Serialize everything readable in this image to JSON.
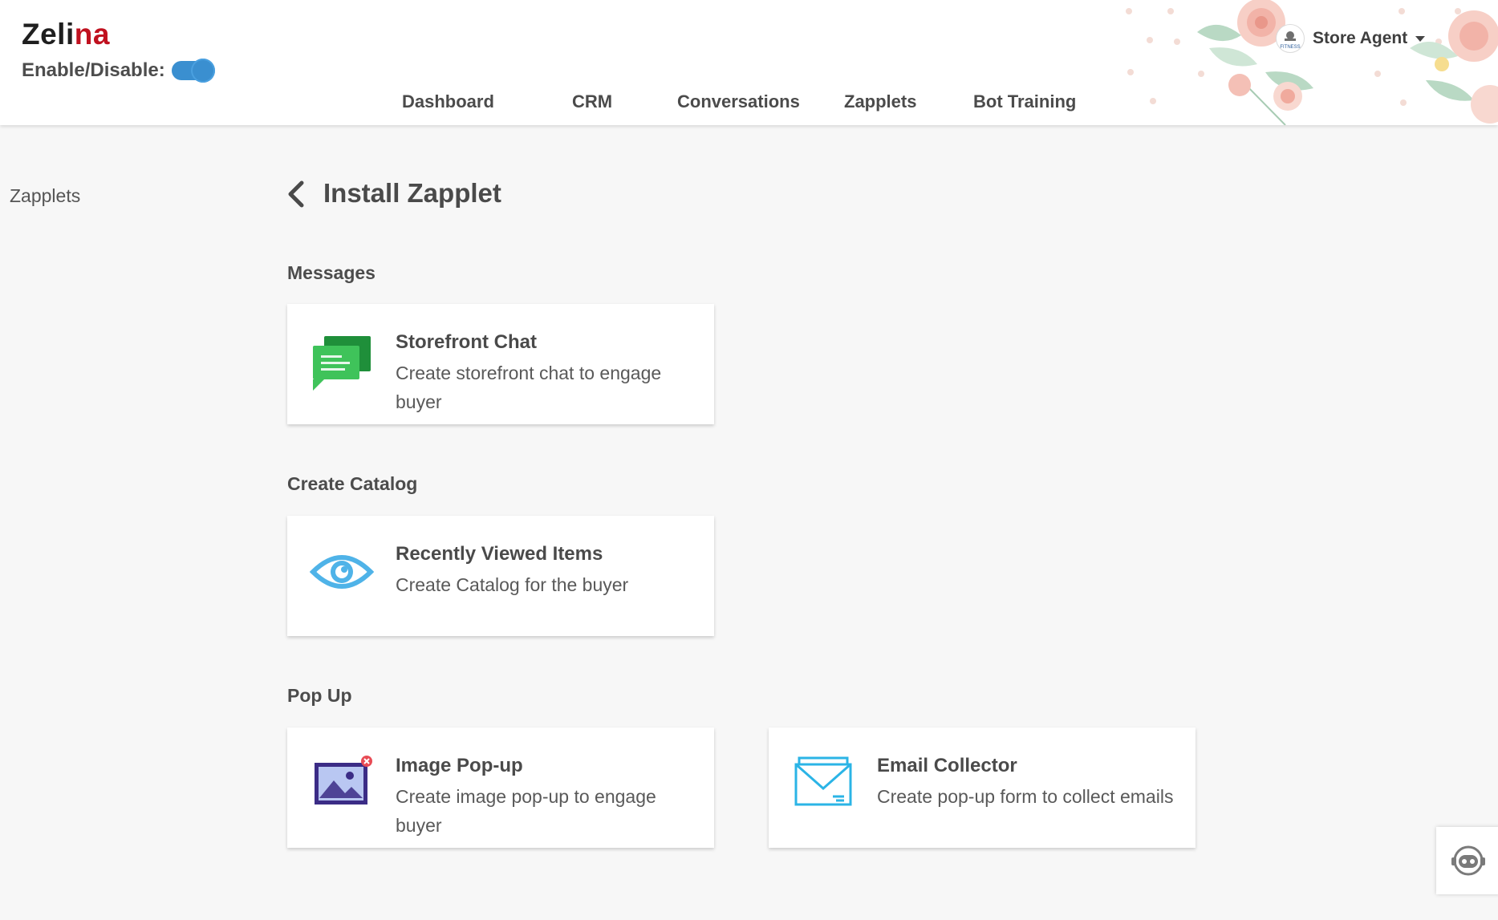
{
  "header": {
    "brand_main": "Zeli",
    "brand_accent": "na",
    "toggle_label": "Enable/Disable:",
    "toggle_on": true,
    "accent_color": "#c0111f",
    "toggle_color": "#3a8fd0"
  },
  "nav": {
    "items": [
      {
        "label": "Dashboard"
      },
      {
        "label": "CRM"
      },
      {
        "label": "Conversations"
      },
      {
        "label": "Zapplets"
      },
      {
        "label": "Bot Training"
      }
    ]
  },
  "agent": {
    "name": "Store Agent",
    "avatar_text": "FITNESS"
  },
  "sidebar": {
    "items": [
      {
        "label": "Zapplets"
      }
    ]
  },
  "main": {
    "title": "Install Zapplet",
    "sections": [
      {
        "title": "Messages",
        "cards": [
          {
            "icon": "chat-bubbles-icon",
            "title": "Storefront Chat",
            "description": "Create storefront chat to engage buyer"
          }
        ]
      },
      {
        "title": "Create Catalog",
        "cards": [
          {
            "icon": "eye-icon",
            "title": "Recently Viewed Items",
            "description": "Create Catalog for the buyer"
          }
        ]
      },
      {
        "title": "Pop Up",
        "cards": [
          {
            "icon": "image-popup-icon",
            "title": "Image Pop-up",
            "description": "Create image pop-up to engage buyer"
          },
          {
            "icon": "envelope-icon",
            "title": "Email Collector",
            "description": "Create pop-up form to collect emails"
          }
        ]
      }
    ]
  },
  "help_widget": {
    "icon": "support-bot-icon"
  }
}
